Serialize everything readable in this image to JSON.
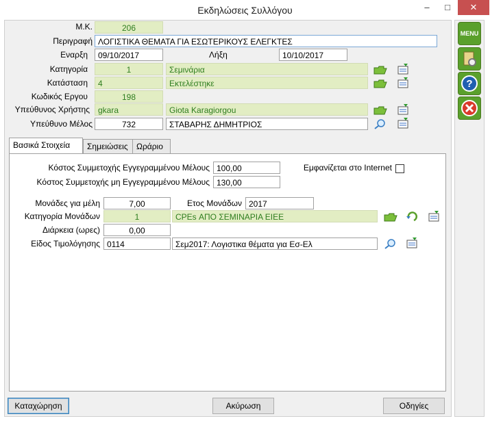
{
  "window": {
    "title": "Εκδηλώσεις Συλλόγου",
    "minimize": "‒",
    "maximize": "□",
    "close": "✕"
  },
  "header": {
    "mk_label": "Μ.Κ.",
    "mk_value": "206",
    "desc_label": "Περιγραφή",
    "desc_value": "ΛΟΓΙΣΤΙΚΑ ΘΕΜΑΤΑ ΓΙΑ ΕΣΩΤΕΡΙΚΟΥΣ ΕΛΕΓΚΤΕΣ",
    "start_label": "Εναρξη",
    "start_value": "09/10/2017",
    "end_label": "Λήξη",
    "end_value": "10/10/2017",
    "category_label": "Κατηγορία",
    "category_code": "1",
    "category_name": "Σεμινάρια",
    "status_label": "Κατάσταση",
    "status_code": "4",
    "status_name": "Εκτελέστηκε",
    "project_label": "Κωδικός Εργου",
    "project_value": "198",
    "user_label": "Υπεύθυνος Χρήστης",
    "user_code": "gkara",
    "user_name": "Giota Karagiorgou",
    "member_label": "Υπεύθυνο Μέλος",
    "member_code": "732",
    "member_name": "ΣΤΑΒΑΡΗΣ ΔΗΜΗΤΡΙΟΣ"
  },
  "tabs": [
    {
      "label": "Βασικά Στοιχεία",
      "active": true
    },
    {
      "label": "Σημειώσεις",
      "active": false
    },
    {
      "label": "Ωράριο",
      "active": false
    }
  ],
  "basic": {
    "cost_reg_label": "Κόστος Συμμετοχής Εγγεγραμμένου Μέλους",
    "cost_reg_value": "100,00",
    "cost_unreg_label": "Κόστος Συμμετοχής μη Εγγεγραμμένου Μέλους",
    "cost_unreg_value": "130,00",
    "internet_label": "Εμφανίζεται στο Internet",
    "internet_checked": false,
    "units_label": "Μονάδες για μέλη",
    "units_value": "7,00",
    "units_year_label": "Ετος Μονάδων",
    "units_year_value": "2017",
    "units_cat_label": "Κατηγορία Μονάδων",
    "units_cat_code": "1",
    "units_cat_name": "CPEs ΑΠΟ ΣΕΜΙΝΑΡΙΑ ΕΙΕΕ",
    "duration_label": "Διάρκεια (ωρες)",
    "duration_value": "0,00",
    "billing_label": "Είδος Τιμολόγησης",
    "billing_code": "0114",
    "billing_name": "Σεμ2017: Λογιστικα θέματα για Εσ-Ελ"
  },
  "buttons": {
    "save": "Καταχώρηση",
    "cancel": "Ακύρωση",
    "help": "Οδηγίες"
  },
  "sidebar": {
    "menu": "MENU"
  },
  "colors": {
    "field_green": "#e2edc3",
    "text_green": "#2e7d1e",
    "close_red": "#c75050",
    "menu_green": "#5aa02c"
  }
}
